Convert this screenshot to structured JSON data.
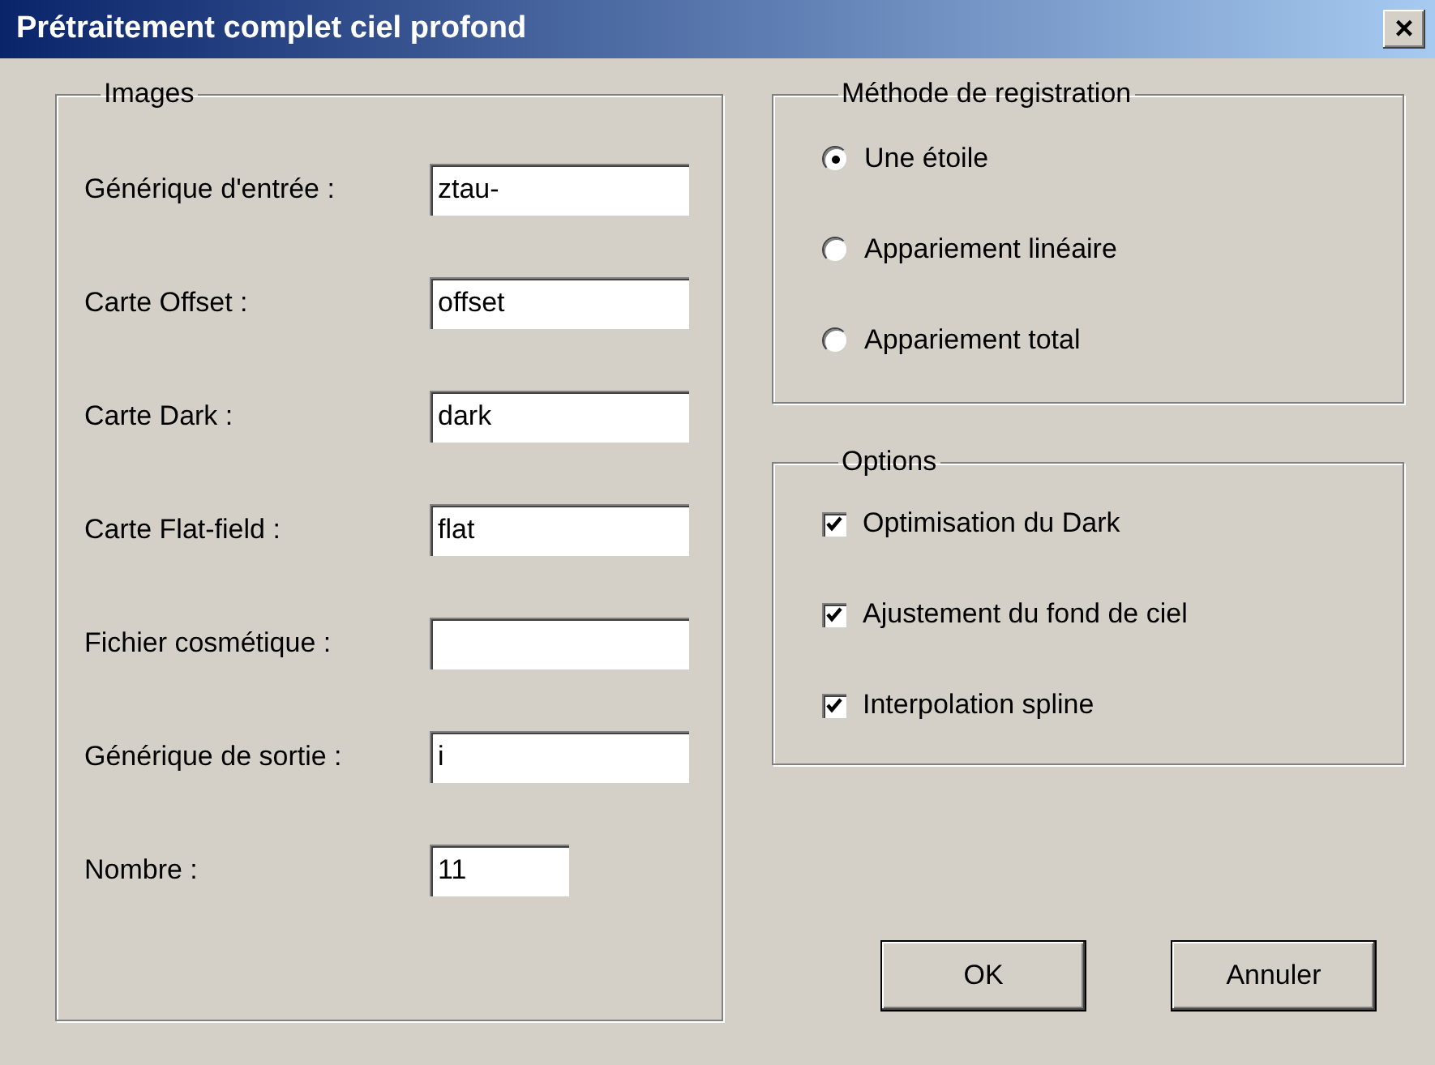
{
  "window": {
    "title": "Prétraitement complet ciel profond",
    "close": "×"
  },
  "images": {
    "title": "Images",
    "fields": [
      {
        "label": "Générique d'entrée :",
        "value": "ztau-",
        "kind": "wide"
      },
      {
        "label": "Carte Offset :",
        "value": "offset",
        "kind": "wide"
      },
      {
        "label": "Carte Dark :",
        "value": "dark",
        "kind": "wide"
      },
      {
        "label": "Carte Flat-field :",
        "value": "flat",
        "kind": "wide"
      },
      {
        "label": "Fichier cosmétique :",
        "kind": "wide"
      },
      {
        "label": "Générique de sortie :",
        "value": "i",
        "kind": "wide"
      },
      {
        "label": "Nombre :",
        "value": "11",
        "kind": "narrow"
      }
    ]
  },
  "registration": {
    "title": "Méthode de registration",
    "options": [
      {
        "label": "Une étoile",
        "selected": true
      },
      {
        "label": "Appariement linéaire",
        "selected": false
      },
      {
        "label": "Appariement total",
        "selected": false
      }
    ]
  },
  "options": {
    "title": "Options",
    "items": [
      {
        "label": "Optimisation du Dark",
        "checked": true
      },
      {
        "label": "Ajustement du fond de ciel",
        "checked": true
      },
      {
        "label": "Interpolation spline",
        "checked": true
      }
    ]
  },
  "buttons": [
    "OK",
    "Annuler"
  ]
}
